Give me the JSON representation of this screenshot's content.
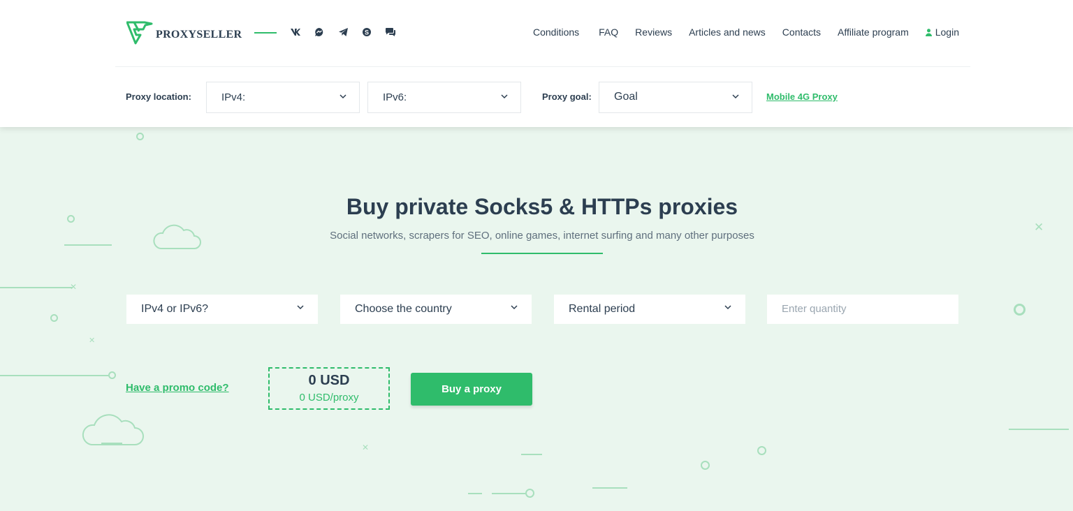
{
  "brand": {
    "name": "PROXYSELLER",
    "accent": "#2fbc6b",
    "text_color": "#2c3e50",
    "background": "#eaf6ee"
  },
  "social_icons": [
    "vk-icon",
    "messenger-icon",
    "telegram-icon",
    "skype-icon",
    "chat-icon"
  ],
  "nav": {
    "items": [
      "Conditions",
      "FAQ",
      "Reviews",
      "Articles and news",
      "Contacts",
      "Affiliate program"
    ],
    "login": "Login"
  },
  "filter_bar": {
    "location_label": "Proxy location:",
    "ipv4_value": "IPv4:",
    "ipv6_value": "IPv6:",
    "goal_label": "Proxy goal:",
    "goal_value": "Goal",
    "mobile_link": "Mobile 4G Proxy"
  },
  "hero": {
    "title": "Buy private Socks5 & HTTPs proxies",
    "subtitle": "Social networks, scrapers for SEO, online games, internet surfing and many other purposes"
  },
  "order_form": {
    "protocol_value": "IPv4 or IPv6?",
    "country_value": "Choose the country",
    "period_value": "Rental period",
    "quantity_placeholder": "Enter quantity",
    "promo_link": "Have a promo code?",
    "total_price": "0 USD",
    "price_per_proxy": "0 USD/proxy",
    "buy_button": "Buy a proxy"
  }
}
